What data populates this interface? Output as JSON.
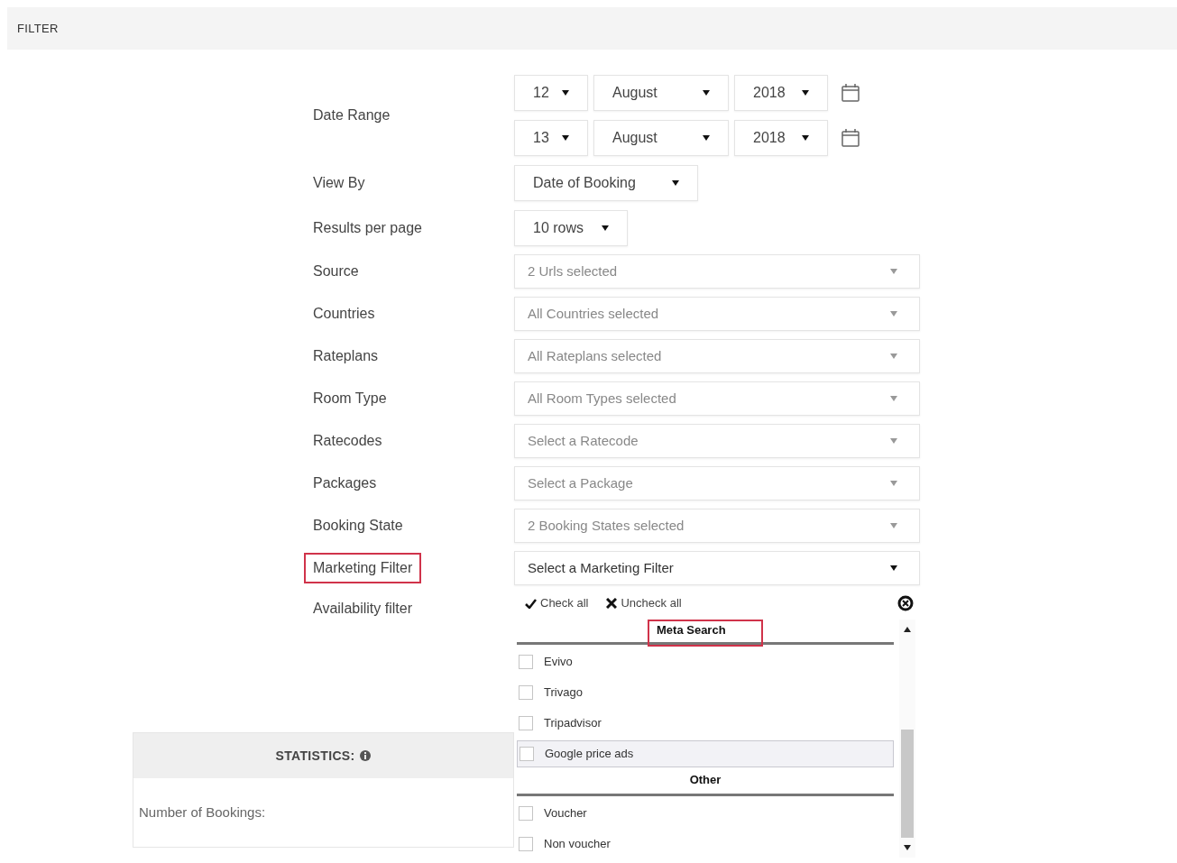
{
  "header": {
    "title": "FILTER"
  },
  "date_range": {
    "label": "Date Range",
    "rows": [
      {
        "day": "12",
        "month": "August",
        "year": "2018"
      },
      {
        "day": "13",
        "month": "August",
        "year": "2018"
      }
    ]
  },
  "view_by": {
    "label": "View By",
    "value": "Date of Booking"
  },
  "results_per_page": {
    "label": "Results per page",
    "value": "10 rows"
  },
  "multiselects": [
    {
      "label": "Source",
      "value": "2 Urls selected",
      "highlighted": false,
      "open": false
    },
    {
      "label": "Countries",
      "value": "All Countries selected",
      "highlighted": false,
      "open": false
    },
    {
      "label": "Rateplans",
      "value": "All Rateplans selected",
      "highlighted": false,
      "open": false
    },
    {
      "label": "Room Type",
      "value": "All Room Types selected",
      "highlighted": false,
      "open": false
    },
    {
      "label": "Ratecodes",
      "value": "Select a Ratecode",
      "highlighted": false,
      "open": false
    },
    {
      "label": "Packages",
      "value": "Select a Package",
      "highlighted": false,
      "open": false
    },
    {
      "label": "Booking State",
      "value": "2 Booking States selected",
      "highlighted": false,
      "open": false
    },
    {
      "label": "Marketing Filter",
      "value": "Select a Marketing Filter",
      "highlighted": true,
      "open": true
    }
  ],
  "availability_filter": {
    "label": "Availability filter"
  },
  "dropdown": {
    "check_all": "Check all",
    "uncheck_all": "Uncheck all",
    "groups": [
      {
        "title": "Meta Search",
        "highlighted": true,
        "items": [
          {
            "label": "Evivo",
            "checked": false,
            "selected": false
          },
          {
            "label": "Trivago",
            "checked": false,
            "selected": false
          },
          {
            "label": "Tripadvisor",
            "checked": false,
            "selected": false
          },
          {
            "label": "Google price ads",
            "checked": false,
            "selected": true
          }
        ]
      },
      {
        "title": "Other",
        "highlighted": false,
        "items": [
          {
            "label": "Voucher",
            "checked": false,
            "selected": false
          },
          {
            "label": "Non voucher",
            "checked": false,
            "selected": false
          }
        ]
      }
    ]
  },
  "statistics": {
    "title": "STATISTICS:",
    "rows": [
      {
        "label": "Number of Bookings:"
      }
    ]
  }
}
